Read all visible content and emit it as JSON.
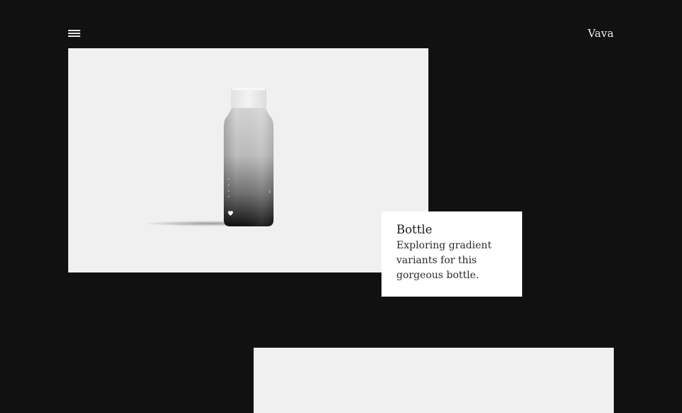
{
  "header": {
    "brand": "Vava",
    "menu_icon": "hamburger-menu-icon"
  },
  "featured": {
    "title": "Bottle",
    "description": "Exploring gradient variants for this gorgeous bottle.",
    "image_icon": "bottle-product-image",
    "heart_icon": "heart-icon"
  },
  "colors": {
    "background": "#111112",
    "card": "#f0f0f0",
    "caption_bg": "#ffffff"
  }
}
